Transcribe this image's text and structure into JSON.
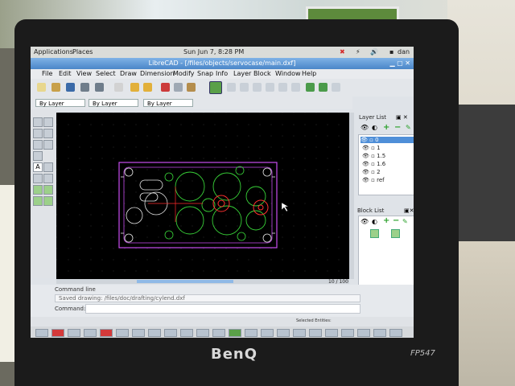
{
  "top_panel": {
    "applications": "Applications",
    "places": "Places",
    "datetime": "Sun Jun  7,  8:28 PM",
    "user": "dan"
  },
  "window": {
    "title": "LibreCAD - [/files/objects/servocase/main.dxf]"
  },
  "menu": [
    "File",
    "Edit",
    "View",
    "Select",
    "Draw",
    "Dimension",
    "Modify",
    "Snap",
    "Info",
    "Layer",
    "Block",
    "Window",
    "Help"
  ],
  "pen": {
    "color": "By Layer",
    "width": "By Layer",
    "linetype": "By Layer"
  },
  "layer_list": {
    "title": "Layer List",
    "layers": [
      "0",
      "1",
      "1.5",
      "1.6",
      "2",
      "ref"
    ],
    "selected": "0"
  },
  "block_list": {
    "title": "Block List"
  },
  "command": {
    "title": "Command line",
    "history": "Saved drawing: /files/doc/drafting/cylend.dxf",
    "prompt": "Command:"
  },
  "status": {
    "grid": "10 / 100",
    "selected": "Selected Entities:"
  },
  "monitor": {
    "brand": "BenQ",
    "model": "FP547"
  },
  "colors": {
    "outline": "#c84cf0",
    "circles": "#38d238",
    "highlight": "#ff3030",
    "crosshair": "#ff2a2a",
    "titlebar": "#4a86c8",
    "accent": "#3a7fd0"
  }
}
